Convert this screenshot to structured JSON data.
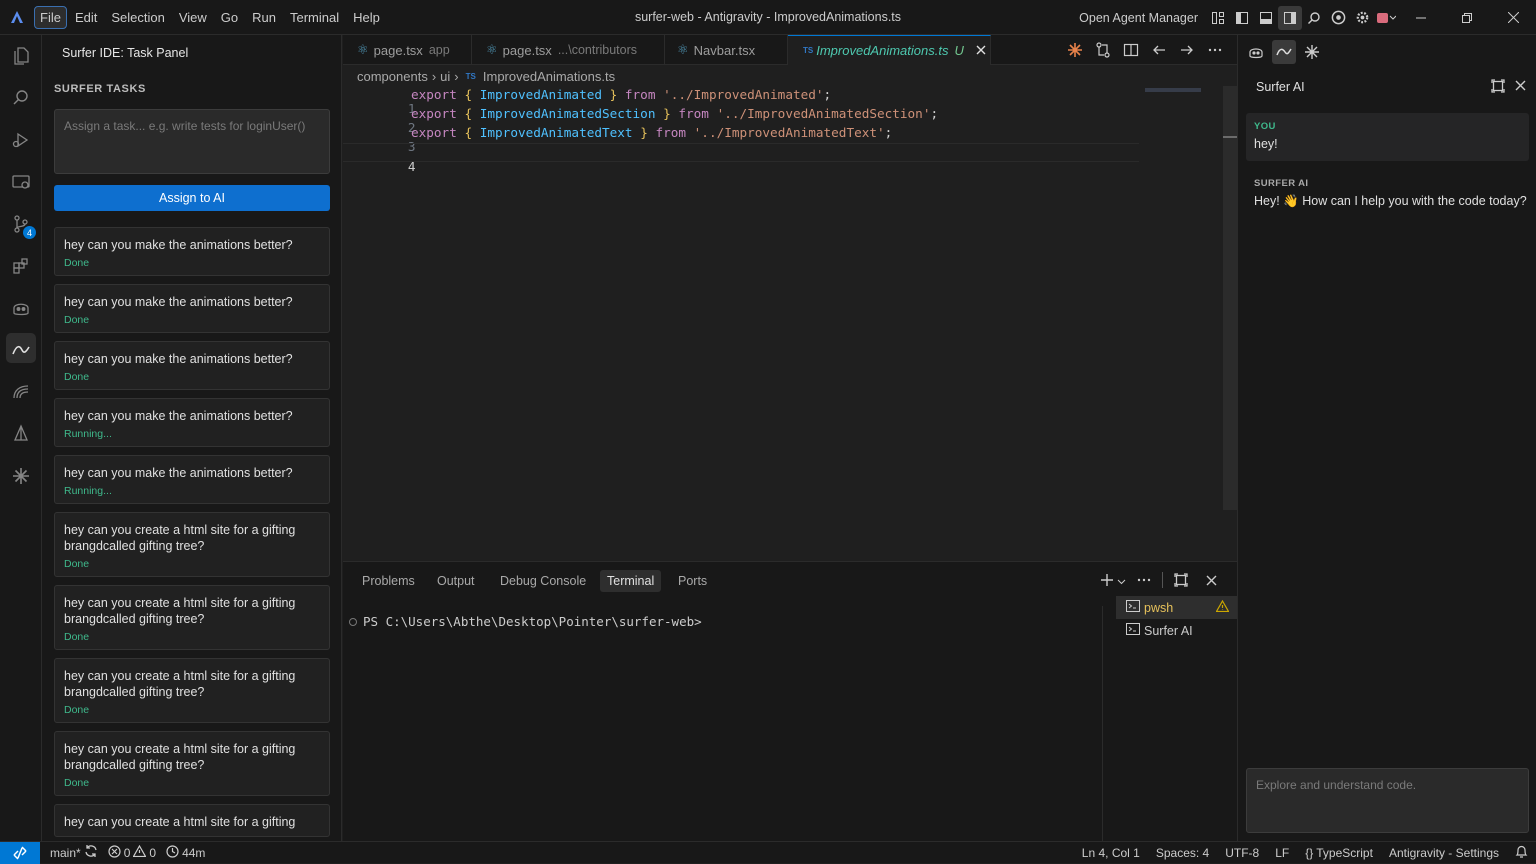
{
  "window": {
    "title": "surfer-web - Antigravity - ImprovedAnimations.ts",
    "agent_manager": "Open Agent Manager"
  },
  "menu": [
    "File",
    "Edit",
    "Selection",
    "View",
    "Go",
    "Run",
    "Terminal",
    "Help"
  ],
  "activity": {
    "source_control_badge": "4"
  },
  "sidebar": {
    "title": "Surfer IDE: Task Panel",
    "section": "SURFER TASKS",
    "input_placeholder": "Assign a task... e.g. write tests for loginUser()",
    "assign_label": "Assign to AI",
    "tasks": [
      {
        "text": "hey can you make the animations better?",
        "status": "Done"
      },
      {
        "text": "hey can you make the animations better?",
        "status": "Done"
      },
      {
        "text": "hey can you make the animations better?",
        "status": "Done"
      },
      {
        "text": "hey can you make the animations better?",
        "status": "Running..."
      },
      {
        "text": "hey can you make the animations better?",
        "status": "Running..."
      },
      {
        "text": "hey can you create a html site for a gifting brangdcalled gifting tree?",
        "status": "Done"
      },
      {
        "text": "hey can you create a html site for a gifting brangdcalled gifting tree?",
        "status": "Done"
      },
      {
        "text": "hey can you create a html site for a gifting brangdcalled gifting tree?",
        "status": "Done"
      },
      {
        "text": "hey can you create a html site for a gifting brangdcalled gifting tree?",
        "status": "Done"
      },
      {
        "text": "hey can you create a html site for a gifting",
        "status": ""
      }
    ]
  },
  "tabs": [
    {
      "name": "page.tsx",
      "desc": "app"
    },
    {
      "name": "page.tsx",
      "desc": "...\\contributors"
    },
    {
      "name": "Navbar.tsx",
      "desc": ""
    },
    {
      "name": "ImprovedAnimations.ts",
      "desc": "U",
      "tag": "TS"
    }
  ],
  "breadcrumb": {
    "parts": [
      "components",
      "ui"
    ],
    "file": "ImprovedAnimations.ts",
    "tag": "TS"
  },
  "code": [
    {
      "n": "1",
      "kw": "export",
      "open": "{",
      "id": "ImprovedAnimated",
      "close": "}",
      "from": "from",
      "path": "'../ImprovedAnimated'",
      "end": ";"
    },
    {
      "n": "2",
      "kw": "export",
      "open": "{",
      "id": "ImprovedAnimatedSection",
      "close": "}",
      "from": "from",
      "path": "'../ImprovedAnimatedSection'",
      "end": ";"
    },
    {
      "n": "3",
      "kw": "export",
      "open": "{",
      "id": "ImprovedAnimatedText",
      "close": "}",
      "from": "from",
      "path": "'../ImprovedAnimatedText'",
      "end": ";"
    },
    {
      "n": "4",
      "kw": "",
      "open": "",
      "id": "",
      "close": "",
      "from": "",
      "path": "",
      "end": ""
    }
  ],
  "panel": {
    "tabs": [
      "Problems",
      "Output",
      "Debug Console",
      "Terminal",
      "Ports"
    ],
    "prompt": "PS C:\\Users\\Abthe\\Desktop\\Pointer\\surfer-web>",
    "terminals": [
      "pwsh",
      "Surfer AI"
    ]
  },
  "chat": {
    "title": "Surfer AI",
    "you_label": "YOU",
    "you_text": "hey!",
    "ai_label": "SURFER AI",
    "ai_text": "Hey! 👋 How can I help you with the code today?",
    "input_placeholder": "Explore and understand code."
  },
  "status": {
    "branch": "main*",
    "errors": "0",
    "warnings": "0",
    "time": "44m",
    "position": "Ln 4, Col 1",
    "spaces": "Spaces: 4",
    "encoding": "UTF-8",
    "eol": "LF",
    "language": "TypeScript",
    "settings": "Antigravity - Settings"
  },
  "colors": {
    "accent": "#0078d4",
    "done": "#3fb98c",
    "keyword": "#c586c0",
    "identifier": "#4fc1ff",
    "string": "#ce9178"
  }
}
